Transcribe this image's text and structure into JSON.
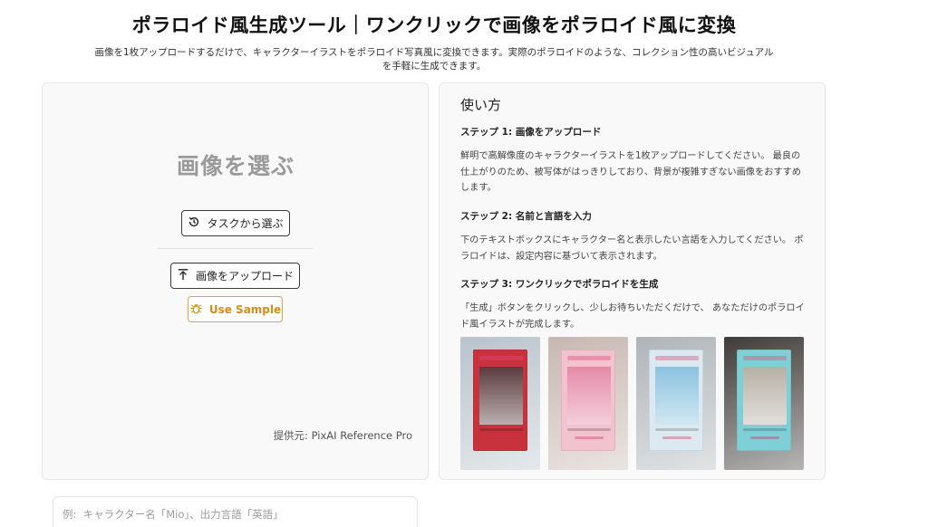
{
  "header": {
    "title": "ポラロイド風生成ツール｜ワンクリックで画像をポラロイド風に変換",
    "subtitle_line1": "画像を1枚アップロードするだけで、キャラクターイラストをポラロイド写真風に変換できます。実際のポラロイドのような、コレクション性の高いビジュアル",
    "subtitle_line2": "を手軽に生成できます。"
  },
  "upload_panel": {
    "heading": "画像を選ぶ",
    "task_button_label": "タスクから選ぶ",
    "task_button_icon": "history-icon",
    "upload_button_label": "画像をアップロード",
    "upload_button_icon": "upload-arrow-icon",
    "sample_button_label": "Use Sample",
    "sample_button_icon": "bug-icon",
    "sample_color": "#d18e1d",
    "credit": "提供元: PixAI Reference Pro"
  },
  "howto": {
    "title": "使い方",
    "steps": [
      {
        "heading": "ステップ 1:  画像をアップロード",
        "lines": [
          "鮮明で高解像度のキャラクターイラストを1枚アップロードしてください。 最良の",
          "仕上がりのため、被写体がはっきりしており、背景が複雑すぎない画像をおすすめ",
          "します。"
        ]
      },
      {
        "heading": "ステップ 2:  名前と言語を入力",
        "lines": [
          "下のテキストボックスにキャラクター名と表示したい言語を入力してください。 ポ",
          "ラロイドは、設定内容に基づいて表示されます。"
        ]
      },
      {
        "heading": "ステップ 3:  ワンクリックでポラロイドを生成",
        "lines": [
          "「生成」ボタンをクリックし、少しお待ちいただくだけで、 あなただけのポラロイ",
          "ド風イラストが完成します。"
        ]
      }
    ],
    "sample_images": [
      {
        "name": "sample-polaroid-1",
        "bg": "#b9c3cc",
        "art": "#5a3b3f",
        "accent": "#c8323c"
      },
      {
        "name": "sample-polaroid-2",
        "bg": "#c7b7b1",
        "art": "#e58aa8",
        "accent": "#f2c3cf"
      },
      {
        "name": "sample-polaroid-3",
        "bg": "#aeb4b8",
        "art": "#8cc3df",
        "accent": "#dce9f0"
      },
      {
        "name": "sample-polaroid-4",
        "bg": "#3f3b38",
        "art": "#b7b0a6",
        "accent": "#7fd0d6"
      }
    ]
  },
  "prompt": {
    "placeholder": "例:  キャラクター名「Mio」、出力言語「英語」"
  }
}
